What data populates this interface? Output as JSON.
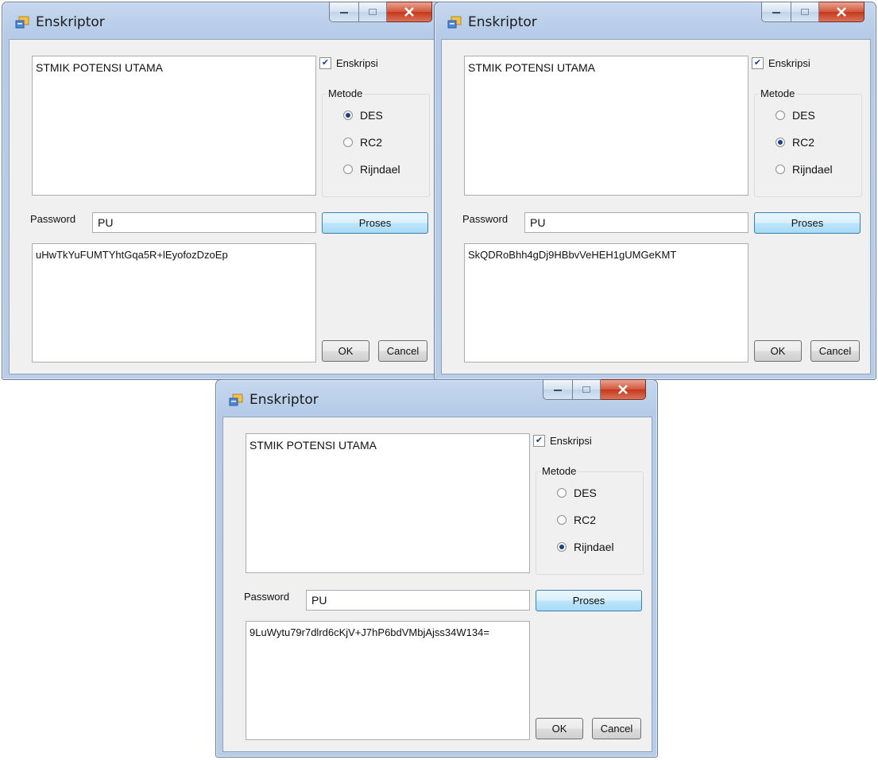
{
  "windows": [
    {
      "title": "Enskriptor",
      "input_text": "STMIK POTENSI UTAMA",
      "checkbox_label": "Enskripsi",
      "checkbox_checked": true,
      "group_label": "Metode",
      "radios": [
        {
          "label": "DES",
          "selected": true
        },
        {
          "label": "RC2",
          "selected": false
        },
        {
          "label": "Rijndael",
          "selected": false
        }
      ],
      "password_label": "Password",
      "password_value": "PU",
      "proses_label": "Proses",
      "output_text": "uHwTkYuFUMTYhtGqa5R+lEyofozDzoEp",
      "ok_label": "OK",
      "cancel_label": "Cancel"
    },
    {
      "title": "Enskriptor",
      "input_text": "STMIK POTENSI UTAMA",
      "checkbox_label": "Enskripsi",
      "checkbox_checked": true,
      "group_label": "Metode",
      "radios": [
        {
          "label": "DES",
          "selected": false
        },
        {
          "label": "RC2",
          "selected": true
        },
        {
          "label": "Rijndael",
          "selected": false
        }
      ],
      "password_label": "Password",
      "password_value": "PU",
      "proses_label": "Proses",
      "output_text": "SkQDRoBhh4gDj9HBbvVeHEH1gUMGeKMT",
      "ok_label": "OK",
      "cancel_label": "Cancel"
    },
    {
      "title": "Enskriptor",
      "input_text": "STMIK POTENSI UTAMA",
      "checkbox_label": "Enskripsi",
      "checkbox_checked": true,
      "group_label": "Metode",
      "radios": [
        {
          "label": "DES",
          "selected": false
        },
        {
          "label": "RC2",
          "selected": false
        },
        {
          "label": "Rijndael",
          "selected": true
        }
      ],
      "password_label": "Password",
      "password_value": "PU",
      "proses_label": "Proses",
      "output_text": "9LuWytu79r7dlrd6cKjV+J7hP6bdVMbjAjss34W134=",
      "ok_label": "OK",
      "cancel_label": "Cancel"
    }
  ],
  "icons": {
    "app": "form-app-icon",
    "minimize": "minimize-icon",
    "maximize": "maximize-icon",
    "close": "close-icon"
  }
}
